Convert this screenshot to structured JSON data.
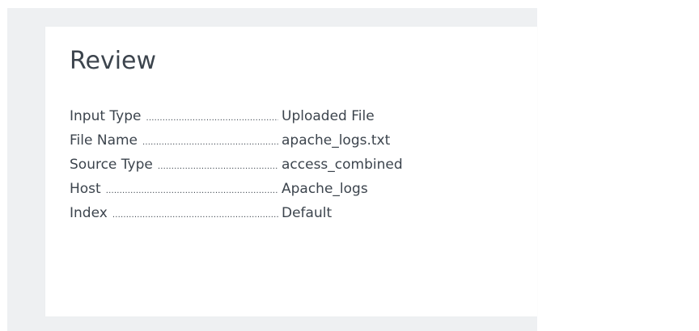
{
  "review": {
    "title": "Review",
    "rows": [
      {
        "label": "Input Type",
        "value": "Uploaded File"
      },
      {
        "label": "File Name",
        "value": "apache_logs.txt"
      },
      {
        "label": "Source Type",
        "value": "access_combined"
      },
      {
        "label": "Host",
        "value": "Apache_logs"
      },
      {
        "label": "Index",
        "value": "Default"
      }
    ]
  }
}
